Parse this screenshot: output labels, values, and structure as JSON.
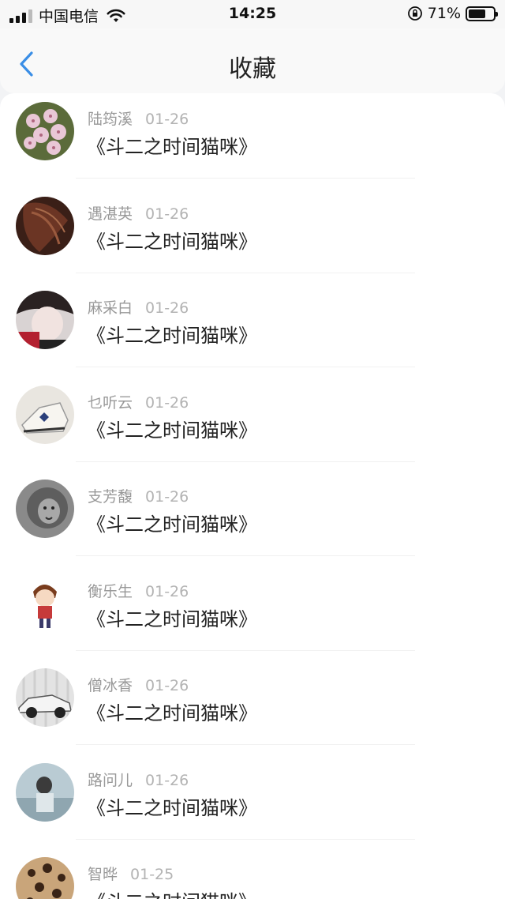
{
  "status_bar": {
    "carrier": "中国电信",
    "time": "14:25",
    "battery_percent": "71%",
    "battery_level": 0.71
  },
  "nav": {
    "title": "收藏",
    "back_icon": "chevron-left-icon"
  },
  "items": [
    {
      "name": "陆筠溪",
      "date": "01-26",
      "title": "《斗二之时间猫咪》",
      "avatar": "flower-avatar"
    },
    {
      "name": "遇湛英",
      "date": "01-26",
      "title": "《斗二之时间猫咪》",
      "avatar": "hair-avatar"
    },
    {
      "name": "麻采白",
      "date": "01-26",
      "title": "《斗二之时间猫咪》",
      "avatar": "girl-avatar"
    },
    {
      "name": "乜听云",
      "date": "01-26",
      "title": "《斗二之时间猫咪》",
      "avatar": "sneaker-avatar"
    },
    {
      "name": "支芳馥",
      "date": "01-26",
      "title": "《斗二之时间猫咪》",
      "avatar": "lion-avatar"
    },
    {
      "name": "衡乐生",
      "date": "01-26",
      "title": "《斗二之时间猫咪》",
      "avatar": "anime-avatar"
    },
    {
      "name": "僧冰香",
      "date": "01-26",
      "title": "《斗二之时间猫咪》",
      "avatar": "car-avatar"
    },
    {
      "name": "路问儿",
      "date": "01-26",
      "title": "《斗二之时间猫咪》",
      "avatar": "photo-avatar"
    },
    {
      "name": "智晔",
      "date": "01-25",
      "title": "《斗二之时间猫咪》",
      "avatar": "pattern-avatar"
    }
  ]
}
